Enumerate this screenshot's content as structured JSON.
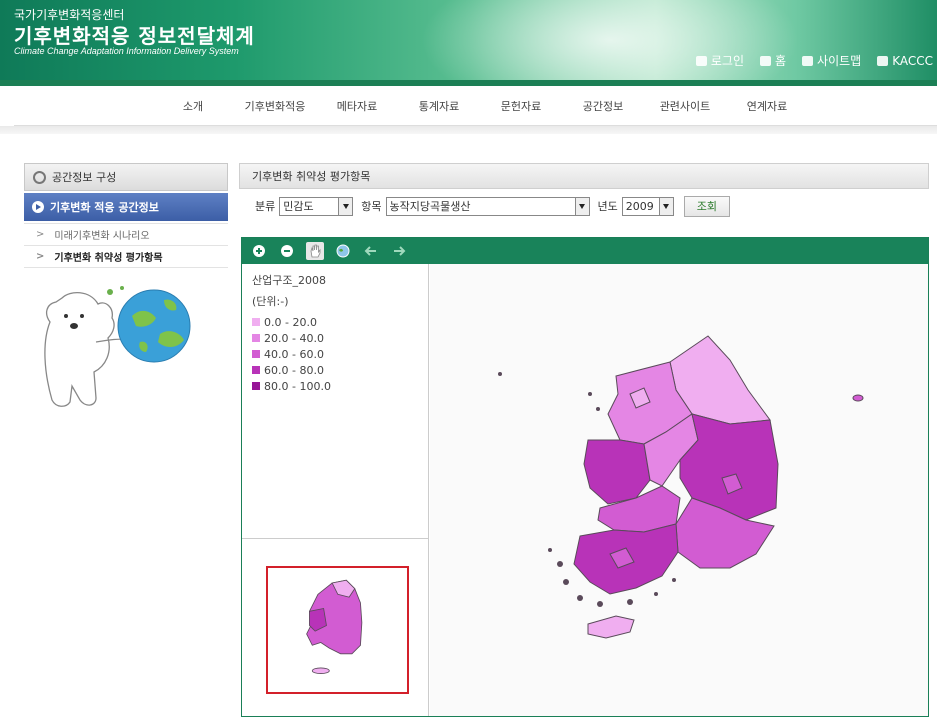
{
  "header": {
    "org_name": "국가기후변화적응센터",
    "title": "기후변화적응 정보전달체계",
    "subtitle": "Climate Change Adaptation Information Delivery System",
    "util_links": [
      {
        "label": "로그인",
        "icon": "login-icon"
      },
      {
        "label": "홈",
        "icon": "home-icon"
      },
      {
        "label": "사이트맵",
        "icon": "sitemap-icon"
      },
      {
        "label": "KACCC",
        "icon": "kaccc-icon"
      }
    ]
  },
  "nav": {
    "items": [
      "소개",
      "기후변화적응",
      "메타자료",
      "통계자료",
      "문헌자료",
      "공간정보",
      "관련사이트",
      "연계자료"
    ]
  },
  "sidebar": {
    "header": "공간정보 구성",
    "active": "기후변화 적응 공간정보",
    "sub_items": [
      {
        "label": "미래기후변화 시나리오",
        "selected": false
      },
      {
        "label": "기후변화 취약성 평가항목",
        "selected": true
      }
    ]
  },
  "content": {
    "title": "기후변화 취약성 평가항목",
    "filters": {
      "category_label": "분류",
      "category_value": "민감도",
      "item_label": "항목",
      "item_value": "농작지당곡물생산",
      "year_label": "년도",
      "year_value": "2009",
      "search_button": "조회"
    }
  },
  "map": {
    "toolbar": [
      "zoom-in-icon",
      "zoom-out-icon",
      "pan-hand-icon",
      "globe-icon",
      "back-arrow-icon",
      "forward-arrow-icon"
    ],
    "legend": {
      "title": "산업구조_2008",
      "unit": "(단위:-)",
      "classes": [
        {
          "label": "0.0 - 20.0",
          "color": "#f0aef0"
        },
        {
          "label": "20.0 - 40.0",
          "color": "#e486e4"
        },
        {
          "label": "40.0 - 60.0",
          "color": "#d25cd2"
        },
        {
          "label": "60.0 - 80.0",
          "color": "#b833b8"
        },
        {
          "label": "80.0 - 100.0",
          "color": "#961696"
        }
      ]
    },
    "colors": {
      "outline": "#5a4a5a",
      "overview_frame": "#d3202a",
      "toolbar_bg": "#19835a"
    }
  }
}
